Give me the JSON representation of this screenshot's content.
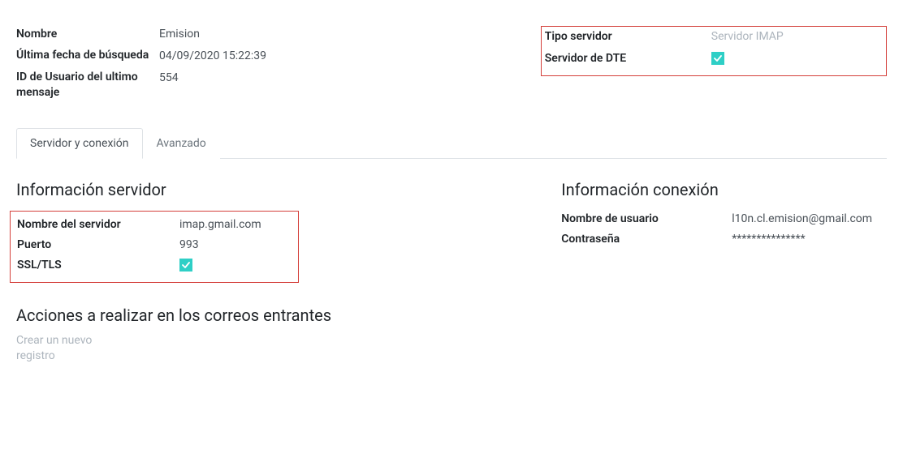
{
  "top_left": {
    "name_label": "Nombre",
    "name_value": "Emision",
    "last_search_label": "Última fecha de búsqueda",
    "last_search_value": "04/09/2020 15:22:39",
    "user_id_label": "ID de Usuario del ultimo mensaje",
    "user_id_value": "554"
  },
  "top_right": {
    "server_type_label": "Tipo servidor",
    "server_type_value": "Servidor IMAP",
    "dte_label": "Servidor de DTE",
    "dte_checked": true
  },
  "tabs": {
    "server_connection": "Servidor y conexión",
    "advanced": "Avanzado"
  },
  "server_info": {
    "title": "Información servidor",
    "server_name_label": "Nombre del servidor",
    "server_name_value": "imap.gmail.com",
    "port_label": "Puerto",
    "port_value": "993",
    "ssl_label": "SSL/TLS",
    "ssl_checked": true
  },
  "conn_info": {
    "title": "Información conexión",
    "user_label": "Nombre de usuario",
    "user_value": "l10n.cl.emision@gmail.com",
    "pass_label": "Contraseña",
    "pass_value": "***************"
  },
  "actions": {
    "title": "Acciones a realizar en los correos entrantes",
    "create_new": "Crear un nuevo registro"
  }
}
